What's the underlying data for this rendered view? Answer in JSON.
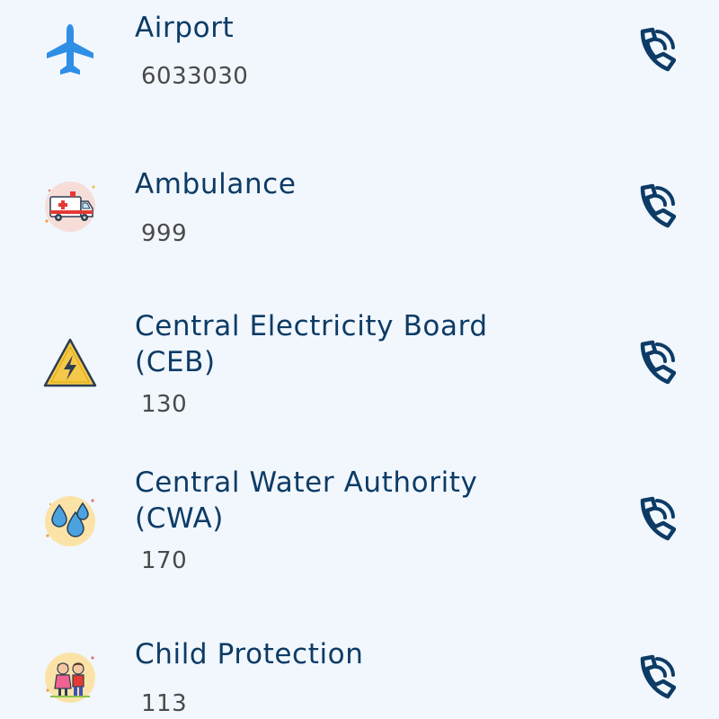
{
  "contacts": [
    {
      "name": "Airport",
      "number": "6033030",
      "icon": "airplane-icon"
    },
    {
      "name": "Ambulance",
      "number": "999",
      "icon": "ambulance-icon"
    },
    {
      "name": "Central Electricity Board (CEB)",
      "number": "130",
      "icon": "electricity-warning-icon"
    },
    {
      "name": "Central Water Authority (CWA)",
      "number": "170",
      "icon": "water-drops-icon"
    },
    {
      "name": "Child Protection",
      "number": "113",
      "icon": "children-icon"
    }
  ],
  "call_icon": "phone-call-icon",
  "colors": {
    "background": "#f1f7fd",
    "title": "#0d3b66",
    "number": "#4a4a4a",
    "call_icon": "#0d3b66",
    "airplane": "#2f8ee6"
  }
}
